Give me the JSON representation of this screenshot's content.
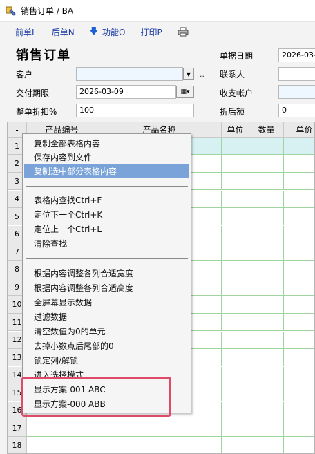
{
  "window": {
    "title": "销售订单 / BA"
  },
  "toolbar": {
    "prev": "前单L",
    "next": "后单N",
    "function": "功能O",
    "print": "打印P"
  },
  "form": {
    "heading": "销售订单",
    "date_label": "单据日期",
    "date_value": "2026-03-0",
    "customer_label": "客户",
    "customer_value": "",
    "ellipsis": "..",
    "contact_label": "联系人",
    "contact_value": "",
    "due_label": "交付期限",
    "due_value": "2026-03-09",
    "account_label": "收支帐户",
    "account_value": "",
    "discount_label": "整单折扣%",
    "discount_value": "100",
    "after_label": "折后额",
    "after_value": "0"
  },
  "grid": {
    "corner": "-",
    "headers": [
      "产品编号",
      "产品名称",
      "单位",
      "数量",
      "单价"
    ],
    "rows": [
      "1",
      "2",
      "3",
      "4",
      "5",
      "6",
      "7",
      "8",
      "9",
      "10",
      "11",
      "12",
      "13",
      "14",
      "15",
      "16",
      "17",
      "18"
    ]
  },
  "context_menu": {
    "group1": [
      "复制全部表格内容",
      "保存内容到文件",
      "复制选中部分表格内容"
    ],
    "group2": [
      "表格内查找Ctrl+F",
      "定位下一个Ctrl+K",
      "定位上一个Ctrl+L",
      "清除查找"
    ],
    "group3": [
      "根据内容调整各列合适宽度",
      "根据内容调整各列合适高度",
      "全屏幕显示数据",
      "过滤数据",
      "清空数值为0的单元",
      "去掉小数点后尾部的0",
      "锁定列/解锁",
      "进入选择模式",
      "显示方案-001 ABC",
      "显示方案-000 ABB"
    ]
  },
  "colors": {
    "highlight": "#7aa3d9",
    "annotation_box": "#e04a6a",
    "grid_line": "#9fd49f"
  }
}
